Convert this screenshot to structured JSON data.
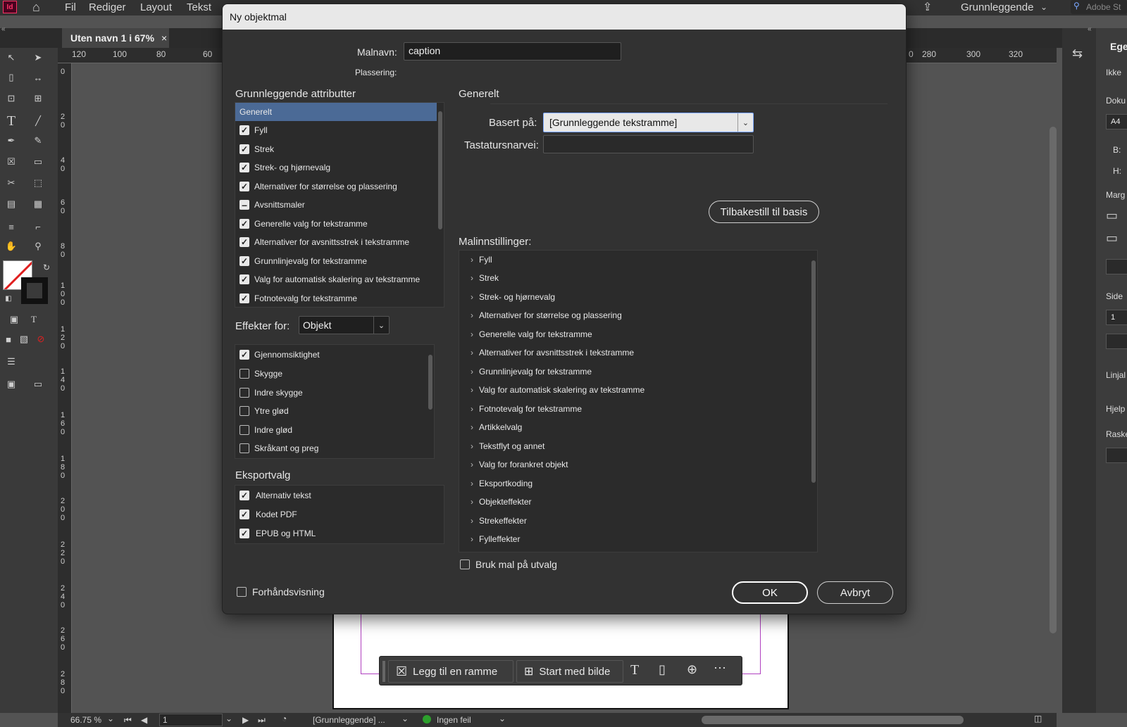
{
  "app": {
    "menu": [
      "Fil",
      "Rediger",
      "Layout",
      "Tekst"
    ],
    "workspace": "Grunnleggende",
    "search_placeholder": "Adobe St",
    "doc_tab": "Uten navn 1 i 67%",
    "doc_tab_close": "×"
  },
  "rulers": {
    "h_left": [
      "120",
      "100",
      "80",
      "60"
    ],
    "h_right": [
      "0",
      "280",
      "300",
      "320"
    ],
    "v": [
      "0",
      "2 0",
      "4 0",
      "6 0",
      "8 0",
      "1 0 0",
      "1 2 0",
      "1 4 0",
      "1 6 0",
      "1 8 0",
      "2 0 0",
      "2 2 0",
      "2 4 0",
      "2 6 0",
      "2 8 0"
    ]
  },
  "dialog": {
    "title": "Ny objektmal",
    "name_label": "Malnavn:",
    "name_value": "caption",
    "placement_label": "Plassering:",
    "basic_attrs_heading": "Grunnleggende attributter",
    "basic_attrs": [
      {
        "label": "Generelt",
        "state": "selected"
      },
      {
        "label": "Fyll",
        "state": "checked"
      },
      {
        "label": "Strek",
        "state": "checked"
      },
      {
        "label": "Strek- og hjørnevalg",
        "state": "checked"
      },
      {
        "label": "Alternativer for størrelse og plassering",
        "state": "checked"
      },
      {
        "label": "Avsnittsmaler",
        "state": "partial"
      },
      {
        "label": "Generelle valg for tekstramme",
        "state": "checked"
      },
      {
        "label": "Alternativer for avsnittsstrek i tekstramme",
        "state": "checked"
      },
      {
        "label": "Grunnlinjevalg for tekstramme",
        "state": "checked"
      },
      {
        "label": "Valg for automatisk skalering av tekstramme",
        "state": "checked"
      },
      {
        "label": "Fotnotevalg for tekstramme",
        "state": "checked"
      }
    ],
    "effects_label": "Effekter for:",
    "effects_value": "Objekt",
    "effects": [
      {
        "label": "Gjennomsiktighet",
        "checked": true
      },
      {
        "label": "Skygge",
        "checked": false
      },
      {
        "label": "Indre skygge",
        "checked": false
      },
      {
        "label": "Ytre glød",
        "checked": false
      },
      {
        "label": "Indre glød",
        "checked": false
      },
      {
        "label": "Skråkant og preg",
        "checked": false
      }
    ],
    "export_heading": "Eksportvalg",
    "export": [
      {
        "label": "Alternativ tekst",
        "checked": true
      },
      {
        "label": "Kodet PDF",
        "checked": true
      },
      {
        "label": "EPUB og HTML",
        "checked": true
      }
    ],
    "preview_label": "Forhåndsvisning",
    "general_heading": "Generelt",
    "based_on_label": "Basert på:",
    "based_on_value": "[Grunnleggende tekstramme]",
    "shortcut_label": "Tastatursnarvei:",
    "shortcut_value": "",
    "reset_button": "Tilbakestill til basis",
    "settings_heading": "Malinnstillinger:",
    "settings": [
      "Fyll",
      "Strek",
      "Strek- og hjørnevalg",
      "Alternativer for størrelse og plassering",
      "Generelle valg for tekstramme",
      "Alternativer for avsnittsstrek i tekstramme",
      "Grunnlinjevalg for tekstramme",
      "Valg for automatisk skalering av tekstramme",
      "Fotnotevalg for tekstramme",
      "Artikkelvalg",
      "Tekstflyt og annet",
      "Valg for forankret objekt",
      "Eksportkoding",
      "Objekteffekter",
      "Strekeffekter",
      "Fylleffekter"
    ],
    "apply_label": "Bruk mal på utvalg",
    "ok_button": "OK",
    "cancel_button": "Avbryt"
  },
  "floatbar": {
    "add_frame": "Legg til en ramme",
    "start_image": "Start med bilde"
  },
  "props": {
    "title": "Ege",
    "ikke": "Ikke",
    "doku": "Doku",
    "a4": "A4",
    "b": "B:",
    "h": "H:",
    "marg": "Marg",
    "side": "Side",
    "side_val": "1",
    "linjal": "Linjal",
    "hjelp": "Hjelp",
    "raske": "Raske"
  },
  "status": {
    "zoom": "66.75 %",
    "page": "1",
    "style": "[Grunnleggende] ...",
    "errors": "Ingen feil"
  }
}
